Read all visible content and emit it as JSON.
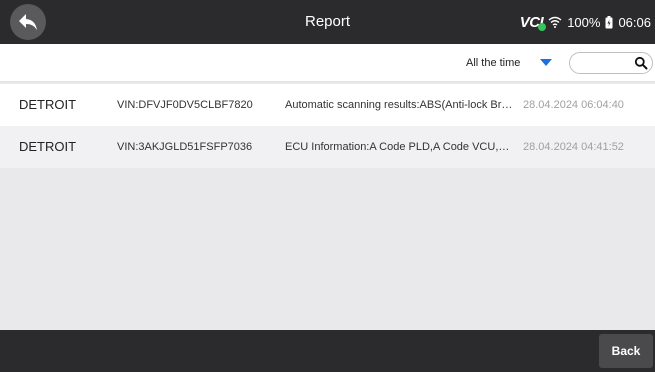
{
  "header": {
    "title": "Report",
    "back_icon": "back-arrow-icon",
    "status": {
      "vci_label": "VCI",
      "wifi_icon": "wifi-icon",
      "battery_percent": "100%",
      "battery_icon": "battery-icon",
      "time": "06:06"
    }
  },
  "filter": {
    "time_range": "All the time",
    "time_range_icon": "dropdown-caret-icon",
    "search_value": "",
    "search_icon": "search-icon"
  },
  "reports": [
    {
      "make": "DETROIT",
      "vin": "VIN:DFVJF0DV5CLBF7820",
      "description": "Automatic scanning results:ABS(Anti-lock Bra...",
      "datetime": "28.04.2024 06:04:40"
    },
    {
      "make": "DETROIT",
      "vin": "VIN:3AKJGLD51FSFP7036",
      "description": "ECU Information:A Code PLD,A Code VCU,Diag...",
      "datetime": "28.04.2024 04:41:52"
    }
  ],
  "footer": {
    "back_label": "Back"
  },
  "colors": {
    "bar_background": "#2b2b2d",
    "accent_blue": "#1f6fe0",
    "vci_connected_green": "#35c35a"
  }
}
